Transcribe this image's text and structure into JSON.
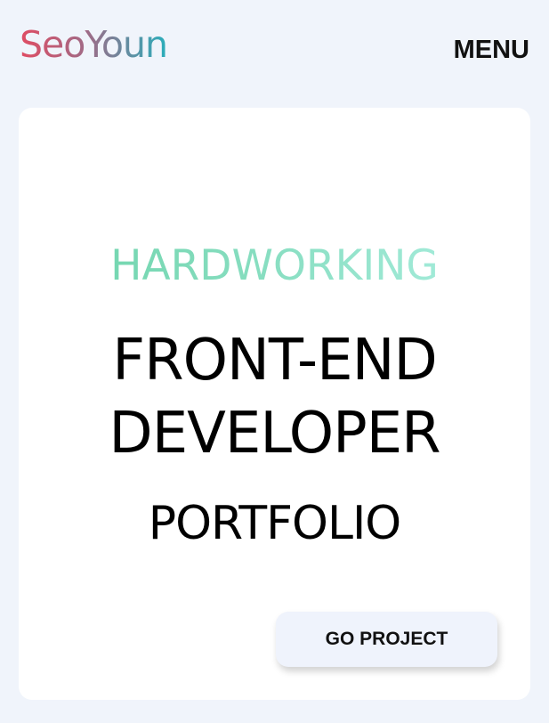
{
  "header": {
    "logo_text": "SeoYoun",
    "menu_label": "MENU"
  },
  "hero": {
    "tagline": "HARDWORKING",
    "title_line1": "FRONT-END",
    "title_line2": "DEVELOPER",
    "subtitle": "PORTFOLIO",
    "cta_label": "GO PROJECT"
  },
  "colors": {
    "page_background": "#f0f4fb",
    "card_background": "#ffffff",
    "logo_gradient": [
      "#e04c63",
      "#a06a86",
      "#2aaebb"
    ],
    "tagline_gradient": [
      "#6bd3a8",
      "#86ddbf",
      "#aef0e3"
    ],
    "button_background": "#eff3fc"
  }
}
